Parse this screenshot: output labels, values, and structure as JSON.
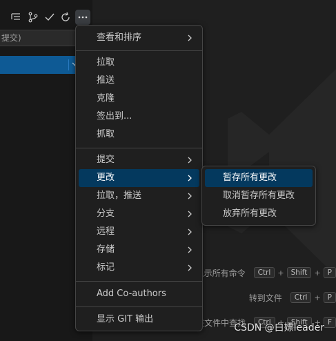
{
  "toolbar": {
    "icons": [
      "view-tree-icon",
      "branch-icon",
      "checkmark-icon",
      "refresh-icon",
      "more-actions-icon"
    ]
  },
  "commit": {
    "input_text": "提交)"
  },
  "menu": {
    "items": [
      {
        "label": "查看和排序",
        "submenu": true
      },
      {
        "label": "拉取"
      },
      {
        "label": "推送"
      },
      {
        "label": "克隆"
      },
      {
        "label": "签出到..."
      },
      {
        "label": "抓取"
      },
      {
        "label": "提交",
        "submenu": true
      },
      {
        "label": "更改",
        "submenu": true,
        "active": true
      },
      {
        "label": "拉取，推送",
        "submenu": true
      },
      {
        "label": "分支",
        "submenu": true
      },
      {
        "label": "远程",
        "submenu": true
      },
      {
        "label": "存储",
        "submenu": true
      },
      {
        "label": "标记",
        "submenu": true
      },
      {
        "label": "Add Co-authors"
      },
      {
        "label": "显示 GIT 输出"
      }
    ]
  },
  "submenu": {
    "items": [
      {
        "label": "暂存所有更改",
        "active": true
      },
      {
        "label": "取消暂存所有更改"
      },
      {
        "label": "放弃所有更改"
      }
    ]
  },
  "shortcuts": [
    {
      "label": "显示所有命令",
      "keys": [
        "Ctrl",
        "Shift",
        "P"
      ]
    },
    {
      "label": "转到文件",
      "keys": [
        "Ctrl",
        "P"
      ]
    },
    {
      "label": "在文件中查找",
      "keys": [
        "Ctrl",
        "Shift",
        "F"
      ]
    }
  ],
  "credit": "CSDN @白嫖leader",
  "colors": {
    "accent": "#04395e",
    "commit_button": "#0e5a95",
    "background": "#1f1f1f"
  }
}
